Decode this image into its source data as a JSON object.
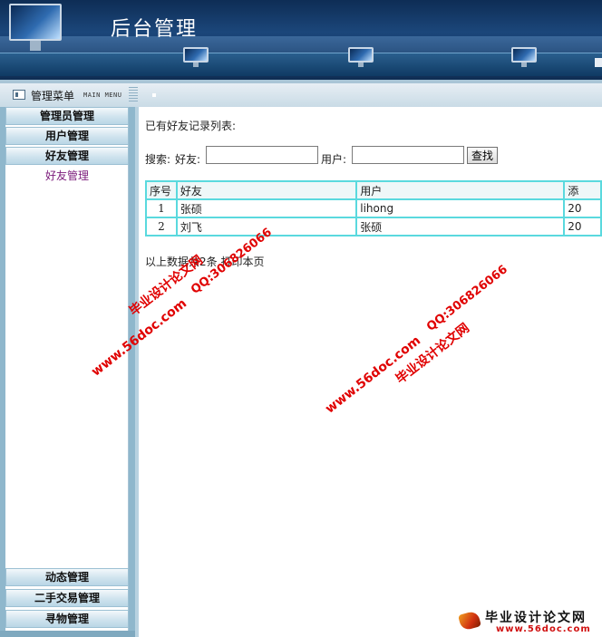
{
  "header": {
    "title": "后台管理"
  },
  "menubar": {
    "title": "管理菜单",
    "subtitle": "MAIN MENU"
  },
  "sidebar": {
    "items": [
      {
        "label": "管理员管理"
      },
      {
        "label": "用户管理"
      },
      {
        "label": "好友管理"
      }
    ],
    "active_sub": "好友管理",
    "bottom_items": [
      {
        "label": "动态管理"
      },
      {
        "label": "二手交易管理"
      },
      {
        "label": "寻物管理"
      }
    ]
  },
  "main": {
    "list_title": "已有好友记录列表:",
    "search": {
      "label": "搜索:",
      "friend_label": "好友:",
      "friend_value": "",
      "user_label": "用户:",
      "user_value": "",
      "button": "查找"
    },
    "table": {
      "headers": [
        "序号",
        "好友",
        "用户",
        "添"
      ],
      "rows": [
        [
          "1",
          "张硕",
          "lihong",
          "20"
        ],
        [
          "2",
          "刘飞",
          "张硕",
          "20"
        ]
      ]
    },
    "summary": "以上数据共2条,打印本页"
  },
  "watermarks": {
    "site_cn": "毕业设计论文网",
    "url": "www.56doc.com",
    "qq": "QQ:306826066"
  },
  "brand": {
    "name": "毕业设计论文网",
    "url": "www.56doc.com"
  },
  "colors": {
    "header_dark": "#0e2d55",
    "sidebar_blue": "#8fb7cc",
    "table_border": "#5ad9de",
    "watermark_red": "#e00000"
  }
}
